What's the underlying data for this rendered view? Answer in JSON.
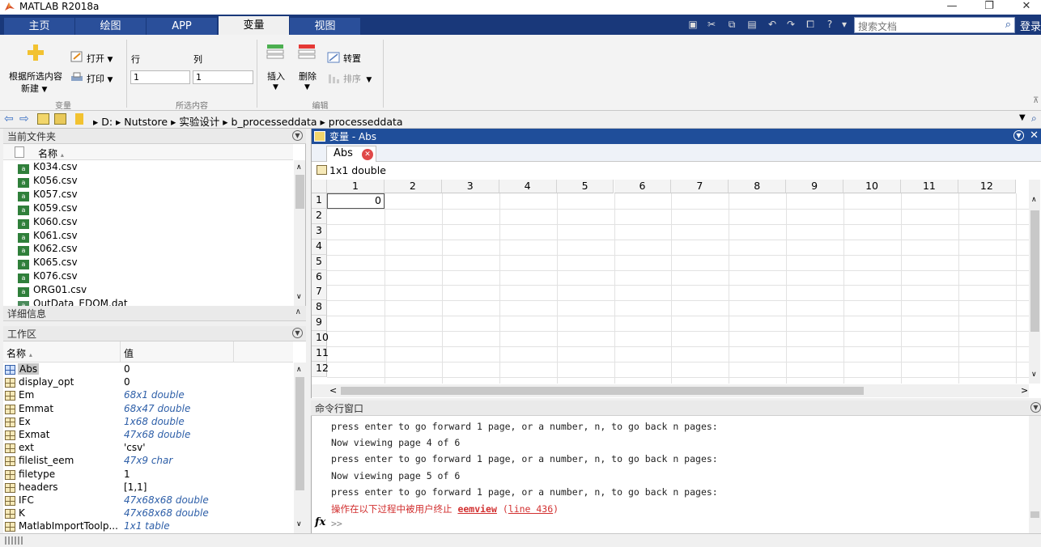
{
  "window": {
    "title": "MATLAB R2018a"
  },
  "ribbon_tabs": [
    "主页",
    "绘图",
    "APP",
    "变量",
    "视图"
  ],
  "search": {
    "placeholder": "搜索文档"
  },
  "login_label": "登录",
  "ribbon": {
    "new_from_selection_line1": "根据所选内容",
    "new_from_selection_line2": "新建",
    "open_label": "打开",
    "print_label": "打印",
    "row_label": "行",
    "col_label": "列",
    "row_value": "1",
    "col_value": "1",
    "insert_label": "插入",
    "delete_label": "删除",
    "transpose_label": "转置",
    "sort_label": "排序",
    "group_variable": "变量",
    "group_selection": "所选内容",
    "group_edit": "编辑"
  },
  "address": {
    "path": "▸ D: ▸ Nutstore ▸ 实验设计 ▸ b_processeddata ▸ processeddata"
  },
  "current_folder": {
    "title": "当前文件夹",
    "name_header": "名称",
    "files": [
      "K034.csv",
      "K056.csv",
      "K057.csv",
      "K059.csv",
      "K060.csv",
      "K061.csv",
      "K062.csv",
      "K065.csv",
      "K076.csv",
      "ORG01.csv",
      "OutData_EDOM.dat"
    ]
  },
  "details": {
    "title": "详细信息"
  },
  "workspace": {
    "title": "工作区",
    "name_header": "名称",
    "value_header": "值",
    "variables": [
      {
        "name": "Abs",
        "value": "0",
        "italic": false
      },
      {
        "name": "display_opt",
        "value": "0",
        "italic": false
      },
      {
        "name": "Em",
        "value": "68x1 double",
        "italic": true
      },
      {
        "name": "Emmat",
        "value": "68x47 double",
        "italic": true
      },
      {
        "name": "Ex",
        "value": "1x68 double",
        "italic": true
      },
      {
        "name": "Exmat",
        "value": "47x68 double",
        "italic": true
      },
      {
        "name": "ext",
        "value": "'csv'",
        "italic": false
      },
      {
        "name": "filelist_eem",
        "value": "47x9 char",
        "italic": true
      },
      {
        "name": "filetype",
        "value": "1",
        "italic": false
      },
      {
        "name": "headers",
        "value": "[1,1]",
        "italic": false
      },
      {
        "name": "IFC",
        "value": "47x68x68 double",
        "italic": true
      },
      {
        "name": "K",
        "value": "47x68x68 double",
        "italic": true
      },
      {
        "name": "MatlabImportToolp...",
        "value": "1x1 table",
        "italic": true
      }
    ]
  },
  "variable_editor": {
    "title": "变量 - Abs",
    "tab_label": "Abs",
    "type_label": "1x1 double",
    "columns": [
      "1",
      "2",
      "3",
      "4",
      "5",
      "6",
      "7",
      "8",
      "9",
      "10",
      "11",
      "12"
    ],
    "rows": [
      "1",
      "2",
      "3",
      "4",
      "5",
      "6",
      "7",
      "8",
      "9",
      "10",
      "11",
      "12"
    ],
    "cell_1_1": "0"
  },
  "command_window": {
    "title": "命令行窗口",
    "lines": [
      "press enter to go forward 1 page, or a number, n, to go back n pages:",
      "Now viewing page 4 of 6",
      "press enter to go forward 1 page, or a number, n, to go back n pages:",
      "Now viewing page 5 of 6",
      "press enter to go forward 1 page, or a number, n, to go back n pages:"
    ],
    "error_prefix": "操作在以下过程中被用户终止 ",
    "error_func": "eemview",
    "error_line_open": " (",
    "error_line": "line 436",
    "error_line_close": ")",
    "prompt_symbol": "fx",
    "prompt": ">>"
  },
  "colors": {
    "tab_strip": "#19387a",
    "editor_header": "#1f4e9a",
    "error_text": "#d23030",
    "italic_value": "#2e5fa8"
  }
}
